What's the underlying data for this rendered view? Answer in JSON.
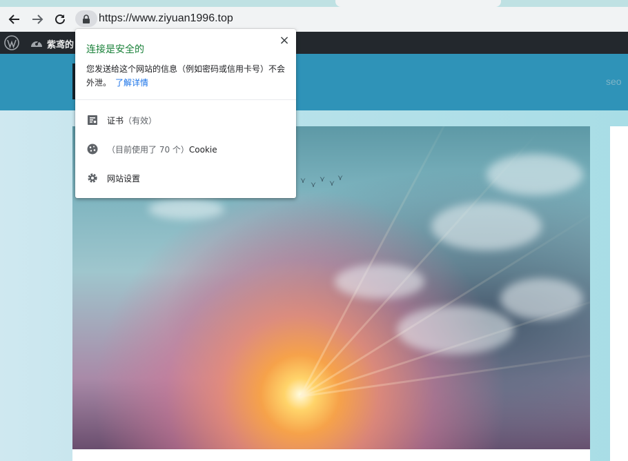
{
  "browser": {
    "url": "https://www.ziyuan1996.top"
  },
  "admin_bar": {
    "site_name": "紫鸢的"
  },
  "site_header": {
    "nav_partial": "seo"
  },
  "popup": {
    "title": "连接是安全的",
    "description": "您发送给这个网站的信息（例如密码或信用卡号）不会外泄。",
    "learn_more": "了解详情",
    "items": [
      {
        "icon": "certificate-icon",
        "label": "证书",
        "sub": "（有效）"
      },
      {
        "icon": "cookie-icon",
        "label_prefix": "（目前使用了 70 个）",
        "label": "Cookie"
      },
      {
        "icon": "gear-icon",
        "label": "网站设置"
      }
    ]
  },
  "colors": {
    "secure_green": "#188038",
    "link_blue": "#1a73e8",
    "admin_bar": "#23282d",
    "site_header": "#2f93b8"
  }
}
